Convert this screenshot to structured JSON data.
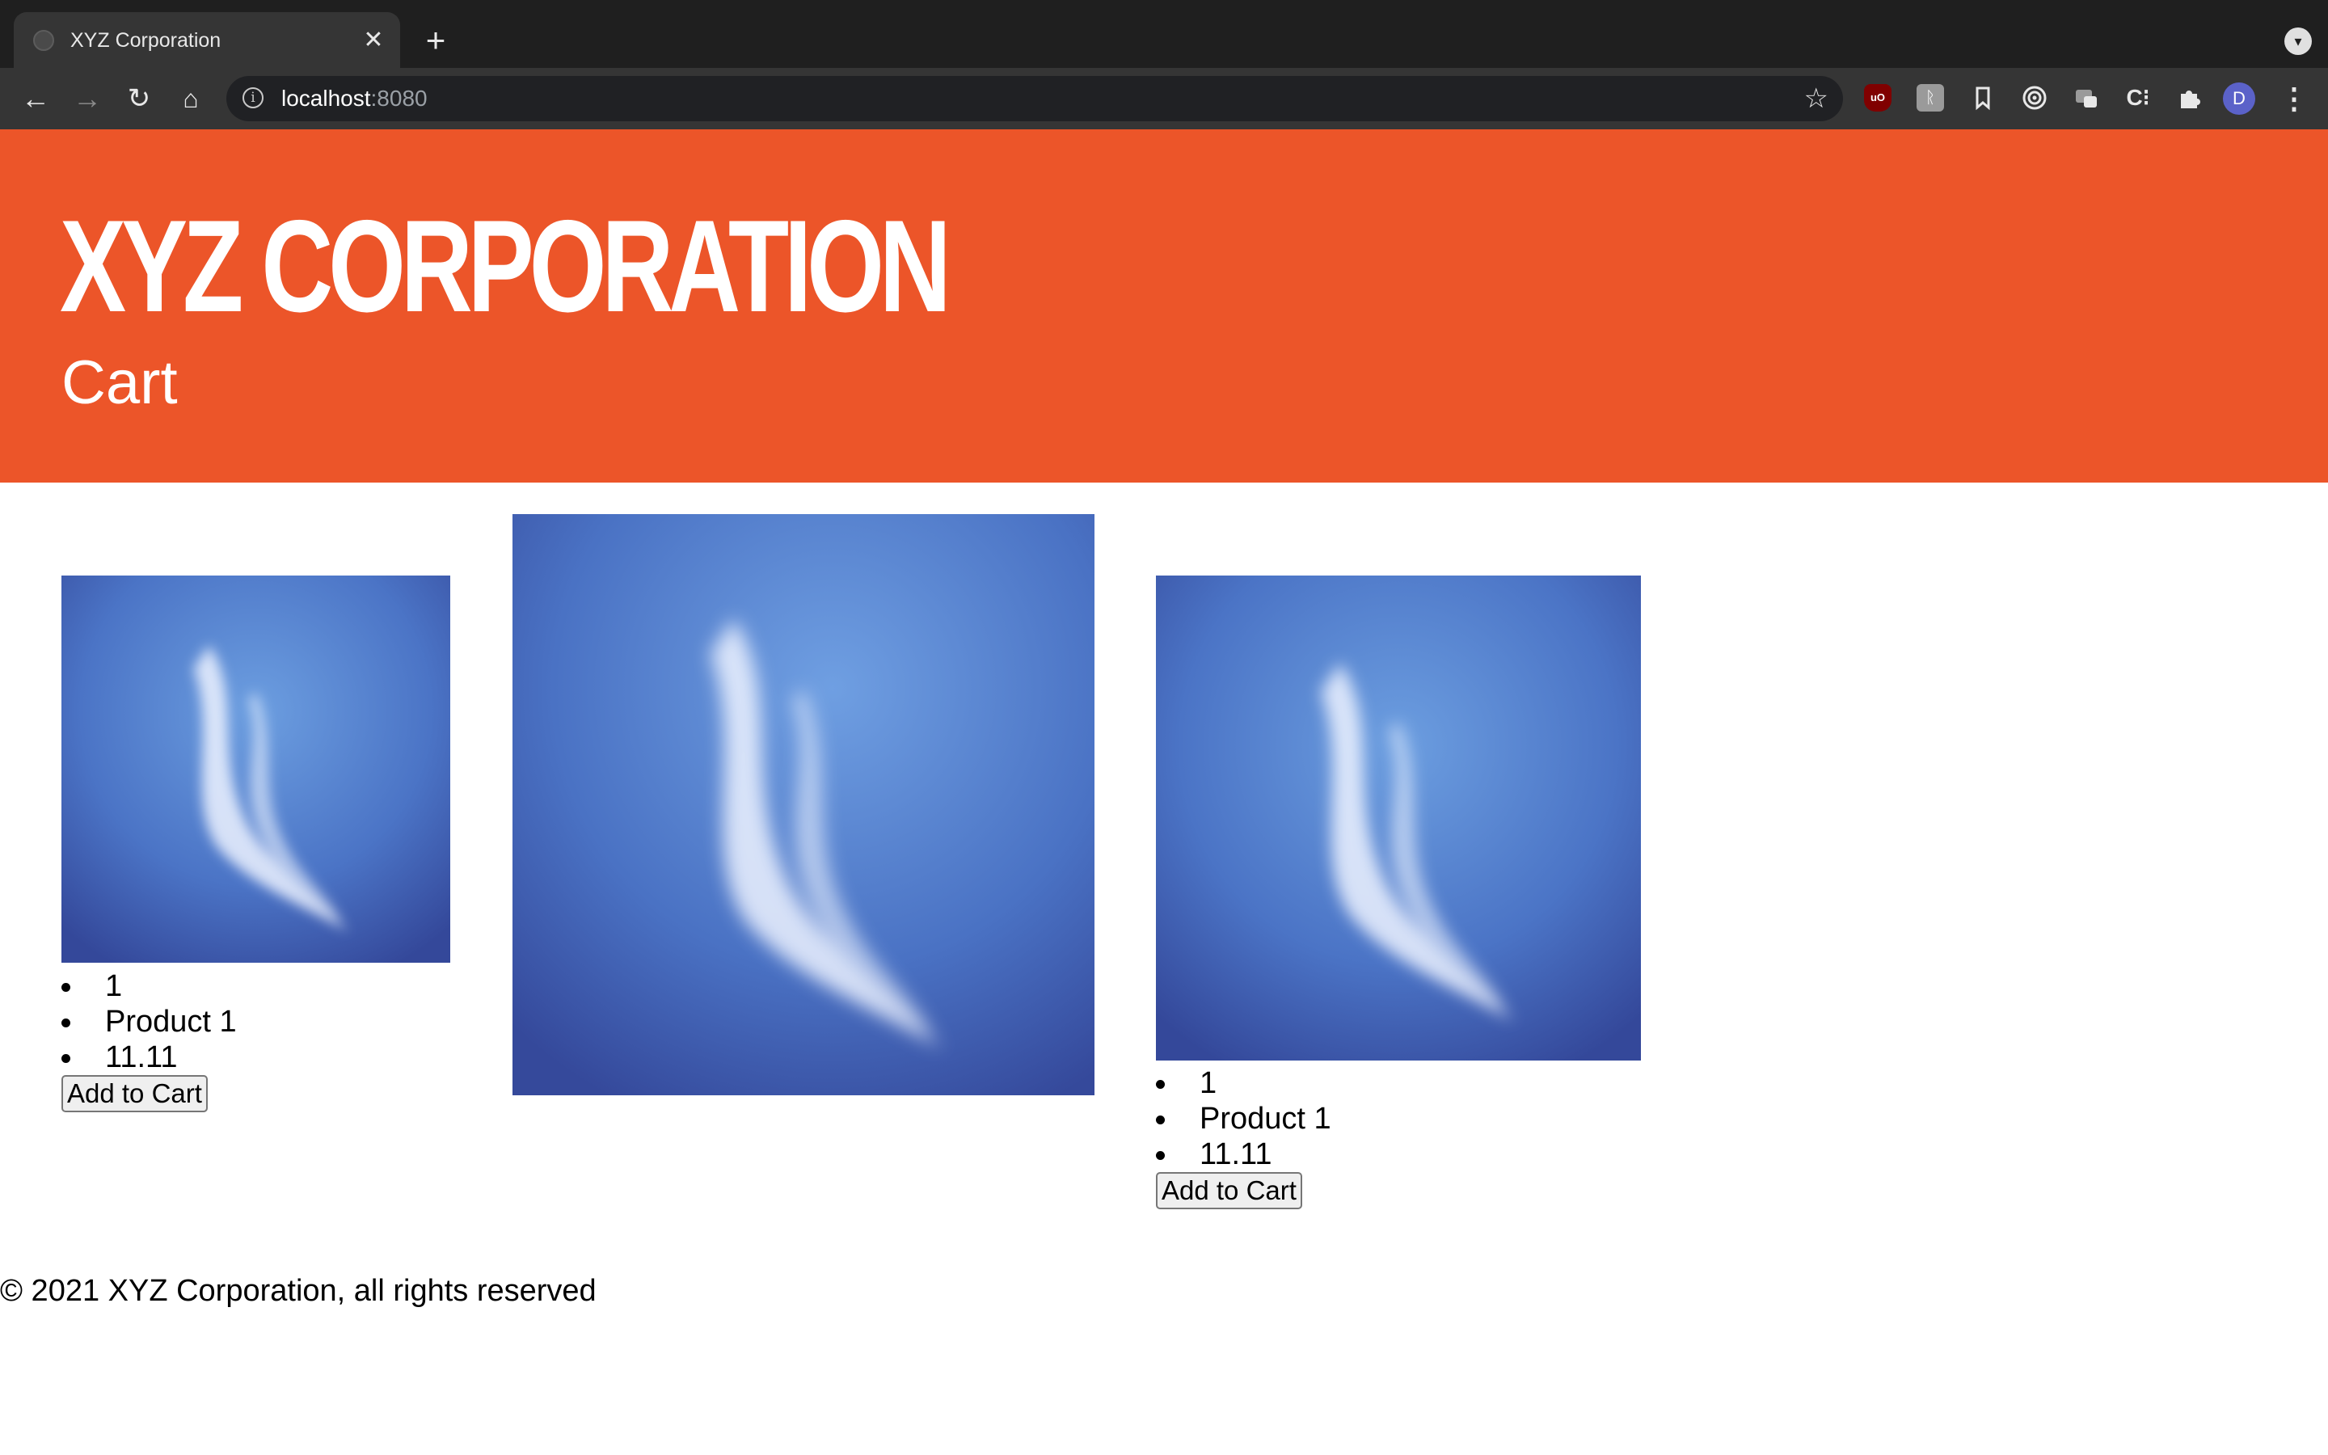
{
  "browser": {
    "tab_title": "XYZ Corporation",
    "tab_close": "✕",
    "new_tab": "+",
    "url_host": "localhost",
    "url_port": ":8080",
    "profile_initial": "D",
    "icons": [
      "back-icon",
      "forward-icon",
      "reload-icon",
      "home-icon",
      "info-icon",
      "star-icon",
      "ublock-icon",
      "extension-icon",
      "bookmark-icon",
      "target-icon",
      "extension-icon",
      "css-extension-icon",
      "puzzle-icon",
      "menu-icon"
    ]
  },
  "header": {
    "brand": "XYZ CORPORATION",
    "subtitle": "Cart",
    "background_color": "#ec5529"
  },
  "products": [
    {
      "id": "1",
      "name": "Product 1",
      "price": "11.11",
      "button_label": "Add to Cart"
    },
    {
      "id": "1",
      "name": "Product 1",
      "price": "11.11",
      "button_label": "Add to Cart"
    }
  ],
  "footer": {
    "text": "© 2021 XYZ Corporation, all rights reserved"
  }
}
